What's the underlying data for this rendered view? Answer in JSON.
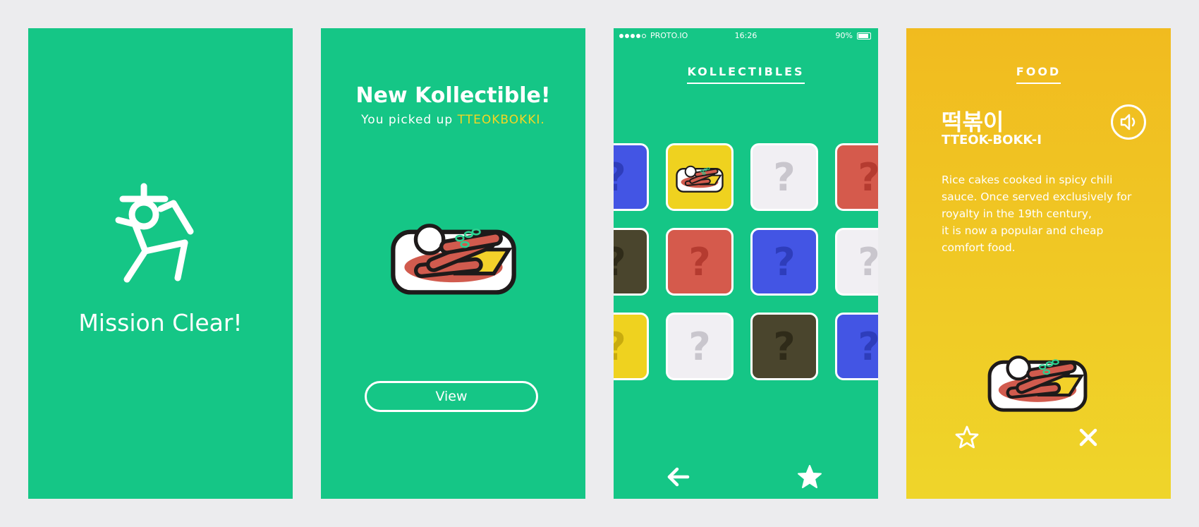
{
  "screen1": {
    "title": "Mission Clear!",
    "icon": "running-character-icon"
  },
  "screen2": {
    "title": "New Kollectible!",
    "subtitle_prefix": "You picked up ",
    "item_name": "TTEOKBOKKI",
    "subtitle_suffix": ".",
    "view_button": "View",
    "highlight_color": "#f5d623"
  },
  "screen3": {
    "status": {
      "carrier": "PROTO.IO",
      "time": "16:26",
      "battery": "90%"
    },
    "title": "KOLLECTIBLES",
    "tiles": [
      [
        "blue",
        "tteokbokki",
        "white",
        "red"
      ],
      [
        "dark",
        "red",
        "blue",
        "white"
      ],
      [
        "yellow",
        "white",
        "dark",
        "blue"
      ]
    ],
    "placeholder": "?",
    "nav": {
      "back": "arrow-left-icon",
      "favorites": "star-filled-icon"
    }
  },
  "screen4": {
    "category": "FOOD",
    "name_korean": "떡볶이",
    "name_romanized": "TTEOK-BOKK-I",
    "description": [
      "Rice cakes cooked in spicy chili",
      "sauce. Once served exclusively for",
      "royalty in the 19th century,",
      "it is now a popular and cheap",
      "comfort food."
    ],
    "nav": {
      "favorite": "star-outline-icon",
      "close": "close-icon"
    }
  },
  "colors": {
    "green": "#15c686",
    "yellow": "#f1c722",
    "tile_blue": "#4355e4",
    "tile_red": "#d55a4c",
    "tile_dark": "#4a452d",
    "tile_yellow": "#efd21f",
    "tile_white": "#f1eff3"
  }
}
